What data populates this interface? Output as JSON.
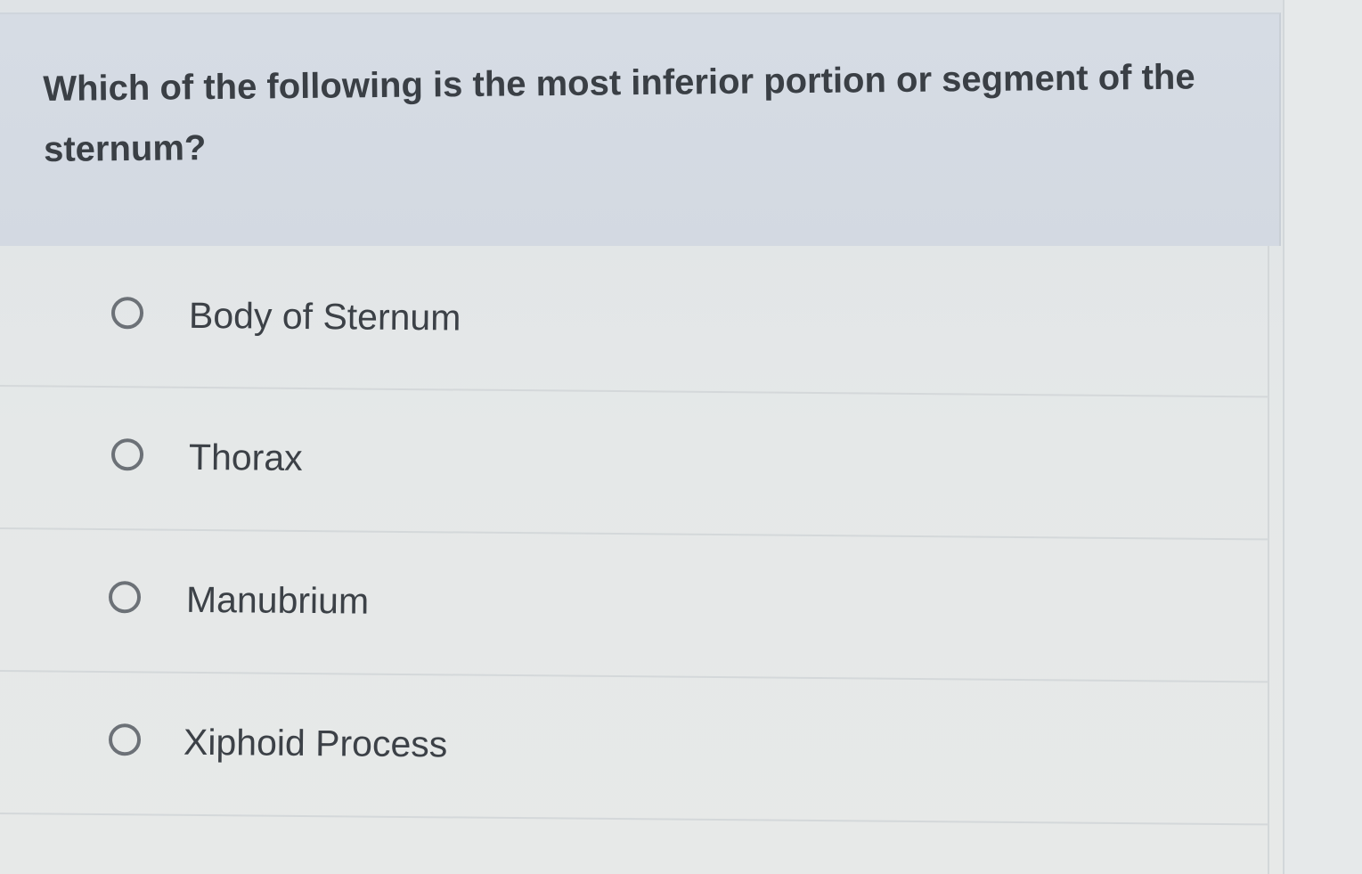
{
  "question": {
    "text": "Which of the following is the most inferior portion or segment of the sternum?"
  },
  "options": [
    {
      "label": "Body of Sternum",
      "selected": false
    },
    {
      "label": "Thorax",
      "selected": false
    },
    {
      "label": "Manubrium",
      "selected": false
    },
    {
      "label": "Xiphoid Process",
      "selected": false
    }
  ],
  "colors": {
    "question_background": "#d6dce4",
    "page_background": "#e3e6e8",
    "text": "#3a3f45",
    "radio_border": "#6c7177"
  }
}
